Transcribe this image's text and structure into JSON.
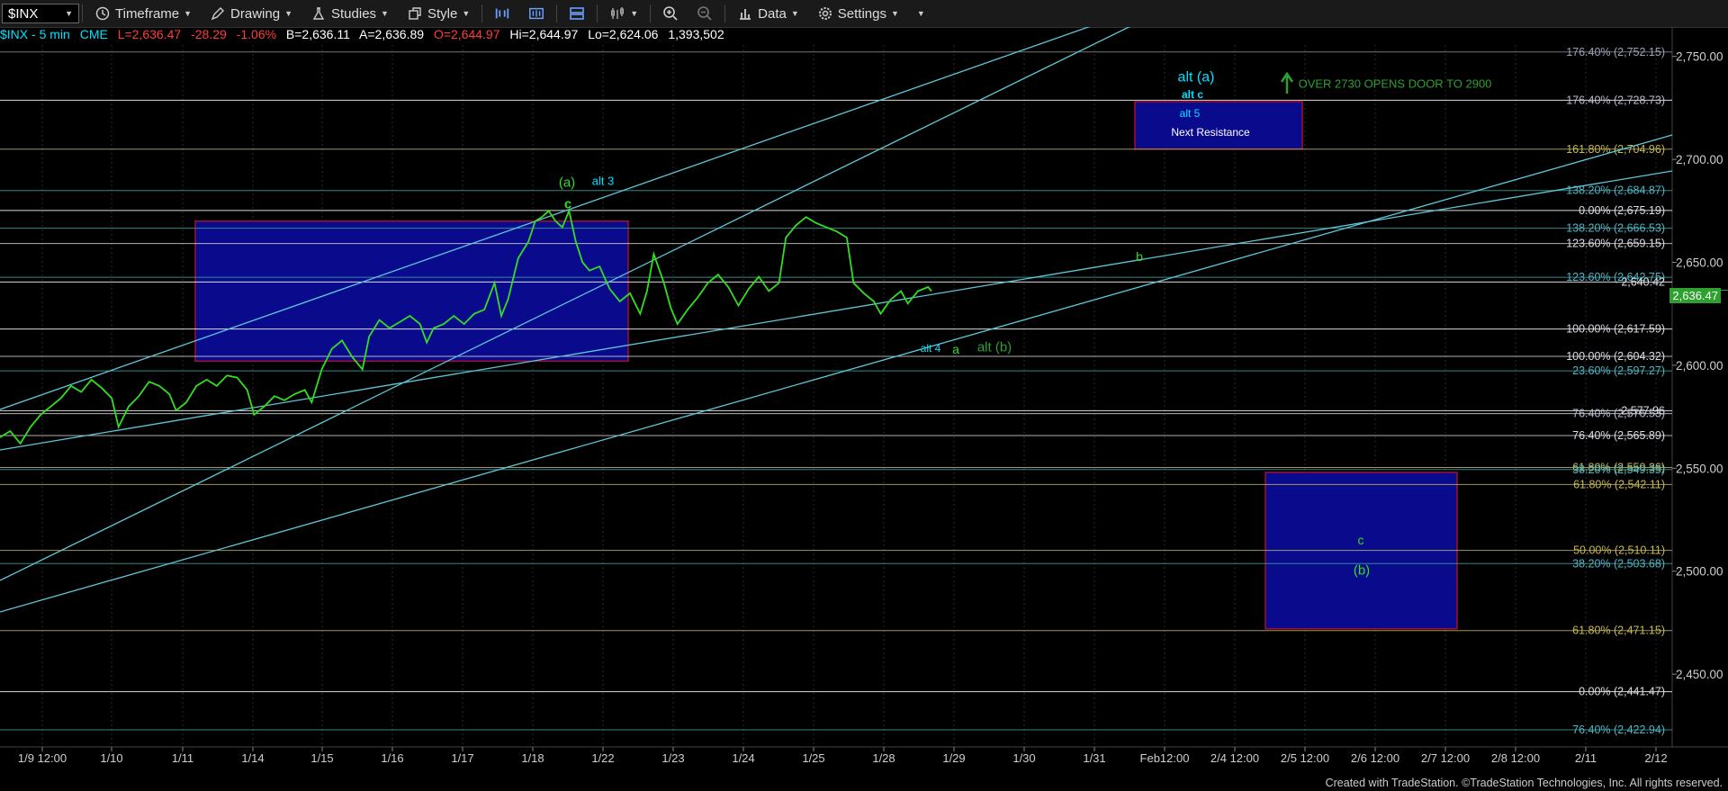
{
  "toolbar": {
    "symbol": "$INX",
    "buttons": [
      {
        "key": "timeframe",
        "label": "Timeframe"
      },
      {
        "key": "drawing",
        "label": "Drawing"
      },
      {
        "key": "studies",
        "label": "Studies"
      },
      {
        "key": "style",
        "label": "Style"
      },
      {
        "key": "data",
        "label": "Data"
      },
      {
        "key": "settings",
        "label": "Settings"
      }
    ]
  },
  "infobar": {
    "symbol": "$INX - 5 min",
    "exchange": "CME",
    "last": "L=2,636.47",
    "change": "-28.29",
    "pct": "-1.06%",
    "bid": "B=2,636.11",
    "ask": "A=2,636.89",
    "open": "O=2,644.97",
    "high": "Hi=2,644.97",
    "low": "Lo=2,624.06",
    "volume": "1,393,502",
    "colors": {
      "symbol": "#00e0ff",
      "down": "#ff3b3b",
      "neutral": "#ffffff",
      "open": "#ff3b3b"
    }
  },
  "current_price_label": "2,636.47",
  "chart_data": {
    "type": "line",
    "series_color": "#33dd22",
    "ylim": [
      2415,
      2765
    ],
    "y_ticks": [
      "2,750.00",
      "2,700.00",
      "2,650.00",
      "2,600.00",
      "2,550.00",
      "2,500.00",
      "2,450.00"
    ],
    "y_tick_values": [
      2750,
      2700,
      2650,
      2600,
      2550,
      2500,
      2450
    ],
    "x_tick_labels": [
      "1/9 12:00",
      "1/10",
      "1/11",
      "1/14",
      "1/15",
      "1/16",
      "1/17",
      "1/18",
      "1/22",
      "1/23",
      "1/24",
      "1/25",
      "1/28",
      "1/29",
      "1/30",
      "1/31",
      "Feb12:00",
      "2/4 12:00",
      "2/5 12:00",
      "2/6 12:00",
      "2/7 12:00",
      "2/8 12:00",
      "2/11",
      "2/12"
    ],
    "price_path": [
      [
        0,
        2565
      ],
      [
        3,
        2568
      ],
      [
        6,
        2562
      ],
      [
        9,
        2570
      ],
      [
        12,
        2576
      ],
      [
        15,
        2580
      ],
      [
        18,
        2584
      ],
      [
        21,
        2590
      ],
      [
        24,
        2587
      ],
      [
        27,
        2593
      ],
      [
        30,
        2589
      ],
      [
        33,
        2584
      ],
      [
        35,
        2570
      ],
      [
        38,
        2580
      ],
      [
        41,
        2585
      ],
      [
        44,
        2592
      ],
      [
        47,
        2590
      ],
      [
        50,
        2586
      ],
      [
        52,
        2578
      ],
      [
        55,
        2582
      ],
      [
        58,
        2590
      ],
      [
        61,
        2593
      ],
      [
        64,
        2590
      ],
      [
        67,
        2595
      ],
      [
        70,
        2594
      ],
      [
        73,
        2588
      ],
      [
        75,
        2576
      ],
      [
        78,
        2580
      ],
      [
        81,
        2585
      ],
      [
        84,
        2583
      ],
      [
        87,
        2586
      ],
      [
        90,
        2588
      ],
      [
        92,
        2582
      ],
      [
        95,
        2598
      ],
      [
        98,
        2608
      ],
      [
        101,
        2612
      ],
      [
        104,
        2604
      ],
      [
        107,
        2598
      ],
      [
        109,
        2614
      ],
      [
        112,
        2622
      ],
      [
        115,
        2618
      ],
      [
        118,
        2621
      ],
      [
        121,
        2624
      ],
      [
        124,
        2620
      ],
      [
        126,
        2611
      ],
      [
        128,
        2618
      ],
      [
        131,
        2620
      ],
      [
        134,
        2624
      ],
      [
        137,
        2620
      ],
      [
        140,
        2625
      ],
      [
        143,
        2627
      ],
      [
        146,
        2640
      ],
      [
        148,
        2624
      ],
      [
        150,
        2632
      ],
      [
        153,
        2652
      ],
      [
        156,
        2660
      ],
      [
        158,
        2670
      ],
      [
        160,
        2672
      ],
      [
        162,
        2675
      ],
      [
        164,
        2670
      ],
      [
        166,
        2667
      ],
      [
        168,
        2675
      ],
      [
        170,
        2660
      ],
      [
        172,
        2650
      ],
      [
        174,
        2646
      ],
      [
        177,
        2648
      ],
      [
        180,
        2637
      ],
      [
        183,
        2631
      ],
      [
        186,
        2635
      ],
      [
        189,
        2625
      ],
      [
        191,
        2636
      ],
      [
        193,
        2654
      ],
      [
        196,
        2640
      ],
      [
        198,
        2628
      ],
      [
        200,
        2620
      ],
      [
        203,
        2627
      ],
      [
        206,
        2633
      ],
      [
        209,
        2640
      ],
      [
        212,
        2644
      ],
      [
        215,
        2638
      ],
      [
        218,
        2629
      ],
      [
        221,
        2637
      ],
      [
        224,
        2643
      ],
      [
        227,
        2636
      ],
      [
        230,
        2640
      ],
      [
        232,
        2662
      ],
      [
        235,
        2668
      ],
      [
        238,
        2672
      ],
      [
        241,
        2669
      ],
      [
        244,
        2667
      ],
      [
        247,
        2665
      ],
      [
        250,
        2662
      ],
      [
        252,
        2640
      ],
      [
        255,
        2635
      ],
      [
        258,
        2631
      ],
      [
        260,
        2625
      ],
      [
        263,
        2632
      ],
      [
        266,
        2636
      ],
      [
        268,
        2630
      ],
      [
        271,
        2636
      ],
      [
        274,
        2638
      ],
      [
        275,
        2636
      ]
    ],
    "fib_lines": [
      {
        "label": "176.40% (2,752.15)",
        "value": 2752.15,
        "color": "#8a8a8a",
        "text": "#9aa0b8"
      },
      {
        "label": "176.40% (2,728.73)",
        "value": 2728.73,
        "color": "#ffffff",
        "text": "#b8bcd0"
      },
      {
        "label": "161.80% (2,704.96)",
        "value": 2704.96,
        "color": "#b8b26a",
        "text": "#c9b84a"
      },
      {
        "label": "138.20% (2,684.87)",
        "value": 2684.87,
        "color": "#3aa0a0",
        "text": "#4db6c6"
      },
      {
        "label": "0.00% (2,675.19)",
        "value": 2675.19,
        "color": "#ffffff",
        "text": "#dcdce6"
      },
      {
        "label": "138.20% (2,666.53)",
        "value": 2666.53,
        "color": "#3aa0a0",
        "text": "#4db6c6"
      },
      {
        "label": "123.60% (2,659.15)",
        "value": 2659.15,
        "color": "#cfcfcf",
        "text": "#dcdce6"
      },
      {
        "label": "123.60% (2,642.75)",
        "value": 2642.75,
        "color": "#3aa0a0",
        "text": "#4db6c6"
      },
      {
        "label": "2,640.42",
        "value": 2640.42,
        "color": "#ffffff",
        "text": "#dcdce6"
      },
      {
        "label": "100.00% (2,617.59)",
        "value": 2617.59,
        "color": "#ffffff",
        "text": "#dcdce6"
      },
      {
        "label": "100.00% (2,604.32)",
        "value": 2604.32,
        "color": "#cfcfcf",
        "text": "#dcdce6"
      },
      {
        "label": "23.60% (2,597.27)",
        "value": 2597.27,
        "color": "#3aa0a0",
        "text": "#4db6c6"
      },
      {
        "label": "2,577.96",
        "value": 2577.96,
        "color": "#ffffff",
        "text": "#dcdce6"
      },
      {
        "label": "76.40% (2,576.53)",
        "value": 2576.53,
        "color": "#cfcfcf",
        "text": "#b8bcd0"
      },
      {
        "label": "76.40% (2,565.89)",
        "value": 2565.89,
        "color": "#cfcfcf",
        "text": "#dcdce6"
      },
      {
        "label": "61.80% (2,550.36)",
        "value": 2550.36,
        "color": "#b8b26a",
        "text": "#c9b84a"
      },
      {
        "label": "38.20% (2,549.35)",
        "value": 2549.35,
        "color": "#3aa0a0",
        "text": "#4db6c6"
      },
      {
        "label": "61.80% (2,542.11)",
        "value": 2542.11,
        "color": "#b8b26a",
        "text": "#c9b84a"
      },
      {
        "label": "50.00% (2,510.11)",
        "value": 2510.11,
        "color": "#b8b26a",
        "text": "#c9b84a"
      },
      {
        "label": "38.20% (2,503.68)",
        "value": 2503.68,
        "color": "#3aa0a0",
        "text": "#4db6c6"
      },
      {
        "label": "61.80% (2,471.15)",
        "value": 2471.15,
        "color": "#b8b26a",
        "text": "#c9b84a"
      },
      {
        "label": "0.00% (2,441.47)",
        "value": 2441.47,
        "color": "#ffffff",
        "text": "#dcdce6"
      },
      {
        "label": "76.40% (2,422.94)",
        "value": 2422.94,
        "color": "#3aa0a0",
        "text": "#4db6c6"
      }
    ],
    "annotations": [
      {
        "text": "(a)",
        "color": "#33dd22"
      },
      {
        "text": "c",
        "color": "#33dd22"
      },
      {
        "text": "alt 3",
        "color": "#00e0ff"
      },
      {
        "text": "alt 4",
        "color": "#00e0ff"
      },
      {
        "text": "a",
        "color": "#33dd22"
      },
      {
        "text": "alt (b)",
        "color": "#2fa02f"
      },
      {
        "text": "b",
        "color": "#33dd22"
      },
      {
        "text": "alt (a)",
        "color": "#00e0ff"
      },
      {
        "text": "alt c",
        "color": "#00e0ff"
      },
      {
        "text": "alt 5",
        "color": "#00e0ff"
      },
      {
        "text": "Next Resistance",
        "color": "#ffffff"
      },
      {
        "text": "OVER 2730 OPENS DOOR TO 2900",
        "color": "#2ea02e"
      },
      {
        "text": "c",
        "color": "#33dd22"
      },
      {
        "text": "(b)",
        "color": "#33dd22"
      }
    ],
    "zones": [
      {
        "name": "consolidation-box",
        "y1": 2670,
        "y2": 2602,
        "fill": "#0a0a8c",
        "stroke": "#a01030"
      },
      {
        "name": "next-resistance-box",
        "y1": 2728,
        "y2": 2705,
        "fill": "#0a0a8c",
        "stroke": "#a01030"
      },
      {
        "name": "target-b-box",
        "y1": 2548,
        "y2": 2472,
        "fill": "#0a0a8c",
        "stroke": "#a01030"
      }
    ]
  },
  "footer": "Created with TradeStation. ©TradeStation Technologies, Inc. All rights reserved."
}
